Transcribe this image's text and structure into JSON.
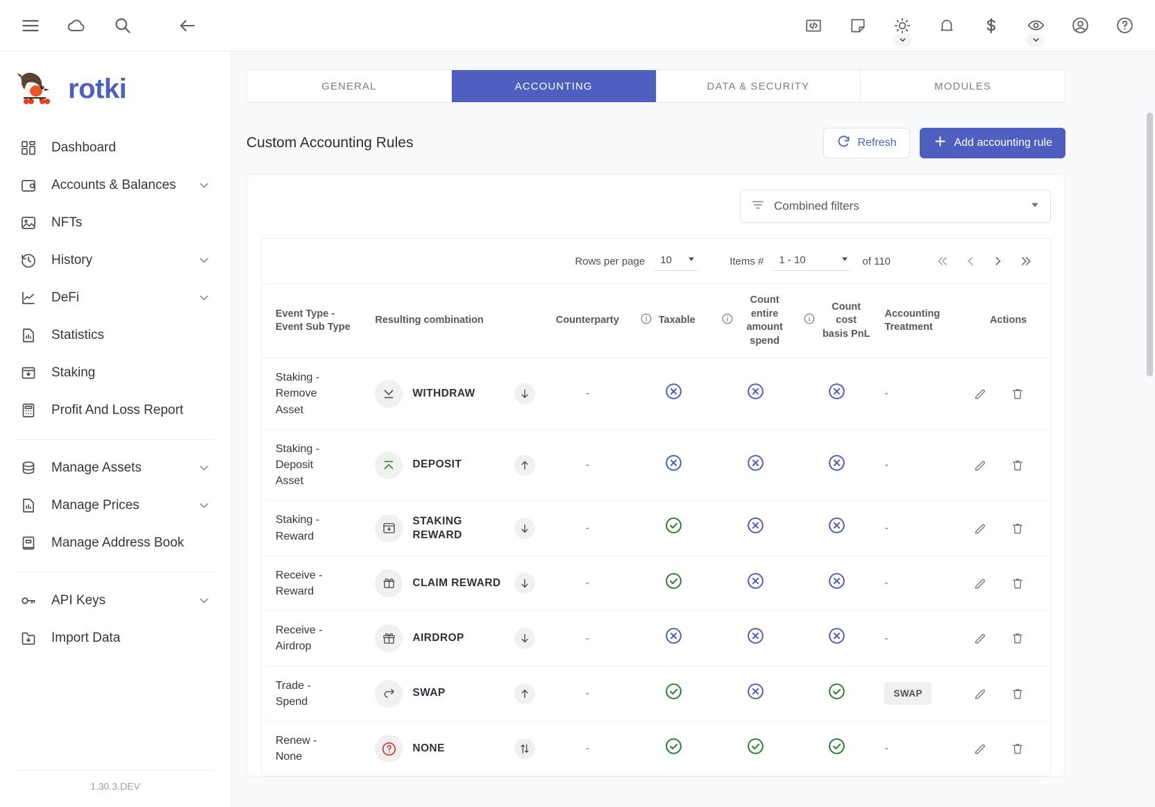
{
  "app": {
    "brand": "rotki",
    "version": "1.30.3.DEV"
  },
  "topbar": {
    "left_icons": [
      {
        "name": "menu-icon",
        "label": "Menu"
      },
      {
        "name": "cloud-sync-icon",
        "label": "Cloud sync"
      },
      {
        "name": "search-icon",
        "label": "Search"
      },
      {
        "name": "back-arrow-icon",
        "label": "Back"
      }
    ],
    "right_icons": [
      {
        "name": "code-icon",
        "label": "Developer"
      },
      {
        "name": "note-icon",
        "label": "Notes"
      },
      {
        "name": "brightness-icon",
        "label": "Theme"
      },
      {
        "name": "bell-icon",
        "label": "Notifications"
      },
      {
        "name": "dollar-icon",
        "label": "Currency"
      },
      {
        "name": "eye-icon",
        "label": "Privacy mode"
      },
      {
        "name": "account-icon",
        "label": "Account"
      },
      {
        "name": "help-icon",
        "label": "Help"
      }
    ]
  },
  "sidebar": {
    "groups": [
      {
        "items": [
          {
            "label": "Dashboard",
            "icon": "dashboard-icon",
            "expandable": false
          },
          {
            "label": "Accounts & Balances",
            "icon": "wallet-icon",
            "expandable": true
          },
          {
            "label": "NFTs",
            "icon": "image-icon",
            "expandable": false
          },
          {
            "label": "History",
            "icon": "history-icon",
            "expandable": true
          },
          {
            "label": "DeFi",
            "icon": "chart-line-icon",
            "expandable": true
          },
          {
            "label": "Statistics",
            "icon": "statistics-icon",
            "expandable": false
          },
          {
            "label": "Staking",
            "icon": "staking-icon",
            "expandable": false
          },
          {
            "label": "Profit And Loss Report",
            "icon": "calculator-icon",
            "expandable": false
          }
        ]
      },
      {
        "items": [
          {
            "label": "Manage Assets",
            "icon": "database-icon",
            "expandable": true
          },
          {
            "label": "Manage Prices",
            "icon": "price-chart-icon",
            "expandable": true
          },
          {
            "label": "Manage Address Book",
            "icon": "address-book-icon",
            "expandable": false
          }
        ]
      },
      {
        "items": [
          {
            "label": "API Keys",
            "icon": "key-icon",
            "expandable": true
          },
          {
            "label": "Import Data",
            "icon": "import-icon",
            "expandable": false
          }
        ]
      }
    ]
  },
  "tabs": [
    {
      "label": "GENERAL",
      "active": false
    },
    {
      "label": "ACCOUNTING",
      "active": true
    },
    {
      "label": "DATA & SECURITY",
      "active": false
    },
    {
      "label": "MODULES",
      "active": false
    }
  ],
  "page": {
    "title": "Custom Accounting Rules",
    "refresh_label": "Refresh",
    "add_label": "Add accounting rule"
  },
  "filters": {
    "placeholder": "Combined filters"
  },
  "pagination": {
    "rows_per_page_label": "Rows per page",
    "rows_per_page_value": "10",
    "items_label": "Items #",
    "items_value": "1 - 10",
    "of_label": "of 110"
  },
  "table": {
    "columns": [
      {
        "key": "event",
        "line1": "Event Type -",
        "line2": "Event Sub Type",
        "info": false
      },
      {
        "key": "combination",
        "line1": "Resulting combination",
        "line2": "",
        "info": false
      },
      {
        "key": "counterparty",
        "line1": "Counterparty",
        "line2": "",
        "info": false
      },
      {
        "key": "taxable",
        "line1": "Taxable",
        "line2": "",
        "info": true
      },
      {
        "key": "count_entire",
        "line1": "Count entire",
        "line2": "amount spend",
        "info": true
      },
      {
        "key": "count_cost",
        "line1": "Count cost",
        "line2": "basis PnL",
        "info": true
      },
      {
        "key": "accounting",
        "line1": "Accounting",
        "line2": "Treatment",
        "info": false
      },
      {
        "key": "actions",
        "line1": "Actions",
        "line2": "",
        "info": false
      }
    ],
    "rows": [
      {
        "event_type": "Staking -",
        "event_subtype": "Remove",
        "event_subtype2": "Asset",
        "combination_label": "WITHDRAW",
        "combination_icon": "withdraw-icon",
        "direction_icon": "arrow-down-icon",
        "counterparty": "-",
        "taxable": "x",
        "count_entire": "x",
        "count_cost": "x",
        "accounting_treatment": "-"
      },
      {
        "event_type": "Staking -",
        "event_subtype": "Deposit",
        "event_subtype2": "Asset",
        "combination_label": "DEPOSIT",
        "combination_icon": "deposit-icon",
        "direction_icon": "arrow-up-icon",
        "counterparty": "-",
        "taxable": "x",
        "count_entire": "x",
        "count_cost": "x",
        "accounting_treatment": "-"
      },
      {
        "event_type": "Staking -",
        "event_subtype": "Reward",
        "event_subtype2": "",
        "combination_label": "STAKING REWARD",
        "combination_icon": "inbox-down-icon",
        "direction_icon": "arrow-down-icon",
        "counterparty": "-",
        "taxable": "check",
        "count_entire": "x",
        "count_cost": "x",
        "accounting_treatment": "-"
      },
      {
        "event_type": "Receive -",
        "event_subtype": "Reward",
        "event_subtype2": "",
        "combination_label": "CLAIM REWARD",
        "combination_icon": "gift-icon",
        "direction_icon": "arrow-down-icon",
        "counterparty": "-",
        "taxable": "check",
        "count_entire": "x",
        "count_cost": "x",
        "accounting_treatment": "-"
      },
      {
        "event_type": "Receive -",
        "event_subtype": "Airdrop",
        "event_subtype2": "",
        "combination_label": "AIRDROP",
        "combination_icon": "gift-ribbon-icon",
        "direction_icon": "arrow-down-icon",
        "counterparty": "-",
        "taxable": "x",
        "count_entire": "x",
        "count_cost": "x",
        "accounting_treatment": "-"
      },
      {
        "event_type": "Trade -",
        "event_subtype": "Spend",
        "event_subtype2": "",
        "combination_label": "SWAP",
        "combination_icon": "swap-icon",
        "direction_icon": "arrow-up-icon",
        "counterparty": "-",
        "taxable": "check",
        "count_entire": "x",
        "count_cost": "check",
        "accounting_treatment": "SWAP"
      },
      {
        "event_type": "Renew -",
        "event_subtype": "None",
        "event_subtype2": "",
        "combination_label": "NONE",
        "combination_icon": "question-circle-icon",
        "direction_icon": "arrow-up-down-icon",
        "counterparty": "-",
        "taxable": "check",
        "count_entire": "check",
        "count_cost": "check",
        "accounting_treatment": "-"
      }
    ]
  },
  "colors": {
    "accent": "#4f5fbf",
    "success": "#2e7d32",
    "danger": "#d32f2f",
    "x_mark": "#4f5fbf",
    "background": "#f8f9fb"
  }
}
